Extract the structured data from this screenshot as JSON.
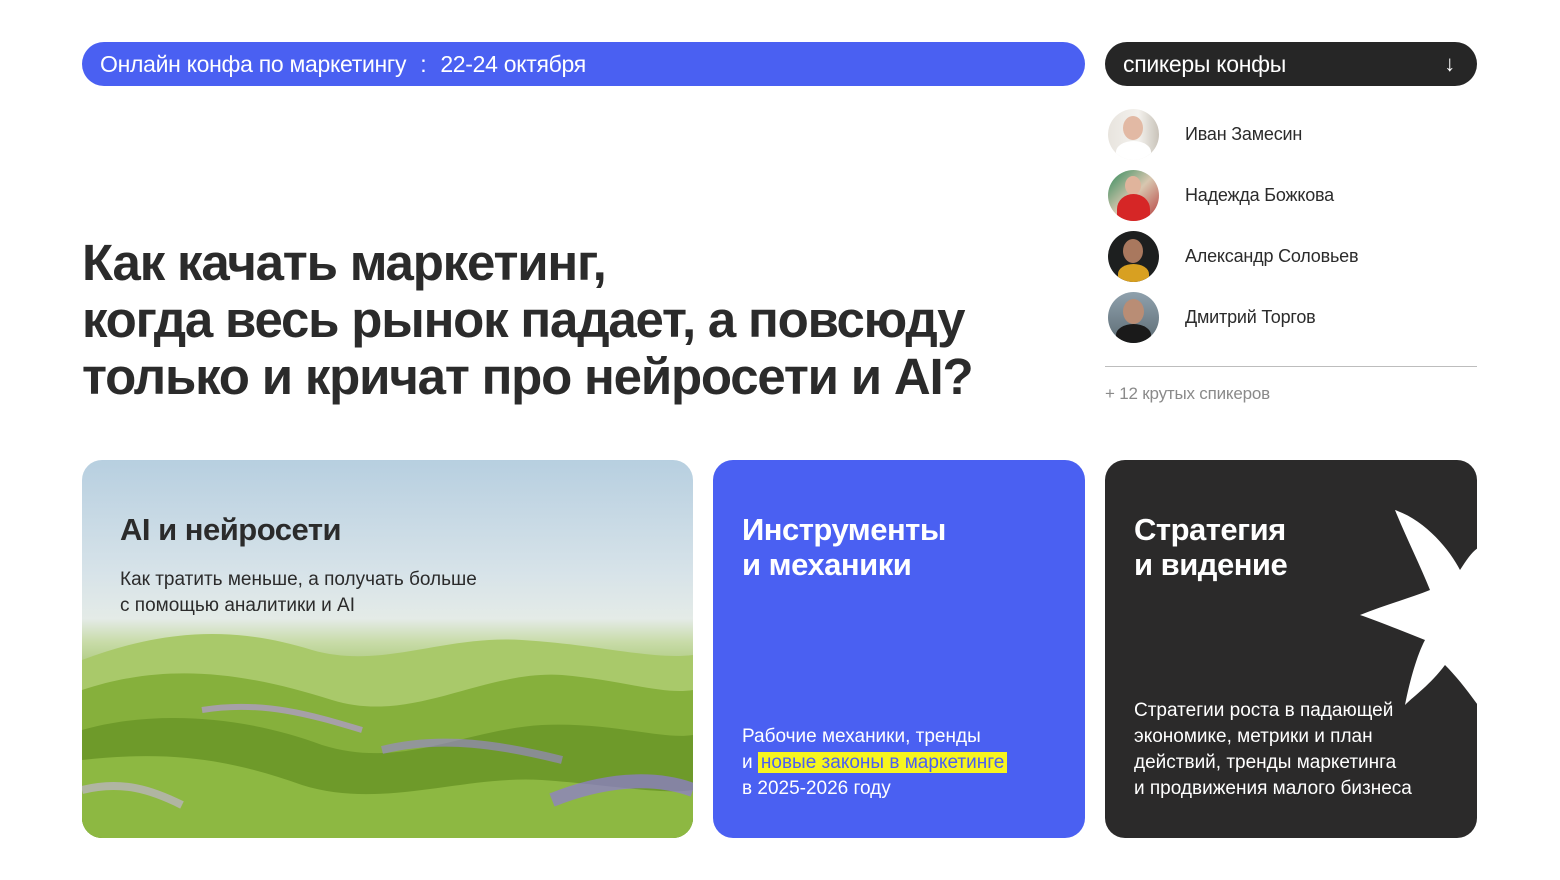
{
  "banner": {
    "event": "Онлайн конфа по маркетингу",
    "separator": ":",
    "dates": "22-24 октября"
  },
  "speakers": {
    "button_label": "спикеры конфы",
    "button_icon": "arrow-down-icon",
    "list": [
      {
        "name": "Иван Замесин"
      },
      {
        "name": "Надежда Божкова"
      },
      {
        "name": "Александр Соловьев"
      },
      {
        "name": "Дмитрий Торгов"
      }
    ],
    "more": "+ 12 крутых спикеров"
  },
  "headline": {
    "line1": "Как качать маркетинг,",
    "line2": "когда весь рынок падает, а повсюду",
    "line3": "только и кричат про нейросети и AI?"
  },
  "cards": {
    "ai": {
      "title": "AI и нейросети",
      "subtitle_line1": "Как тратить меньше, а получать больше",
      "subtitle_line2": "с помощью аналитики и AI"
    },
    "tools": {
      "title_line1": "Инструменты",
      "title_line2": "и механики",
      "desc_line1": "Рабочие механики, тренды",
      "desc_line2_prefix": "и",
      "desc_highlight": "новые законы в маркетинге",
      "desc_line3": "в 2025-2026 году"
    },
    "strategy": {
      "title_line1": "Стратегия",
      "title_line2": "и видение",
      "desc_line1": "Стратегии роста в падающей",
      "desc_line2": "экономике, метрики и план",
      "desc_line3": "действий, тренды маркетинга",
      "desc_line4": "и продвижения малого бизнеса"
    }
  },
  "colors": {
    "accent_blue": "#4a60f2",
    "dark": "#2b2a2a",
    "highlight_yellow": "#f7f51e",
    "text": "#2b2b2b",
    "muted": "#8a8a8a"
  }
}
